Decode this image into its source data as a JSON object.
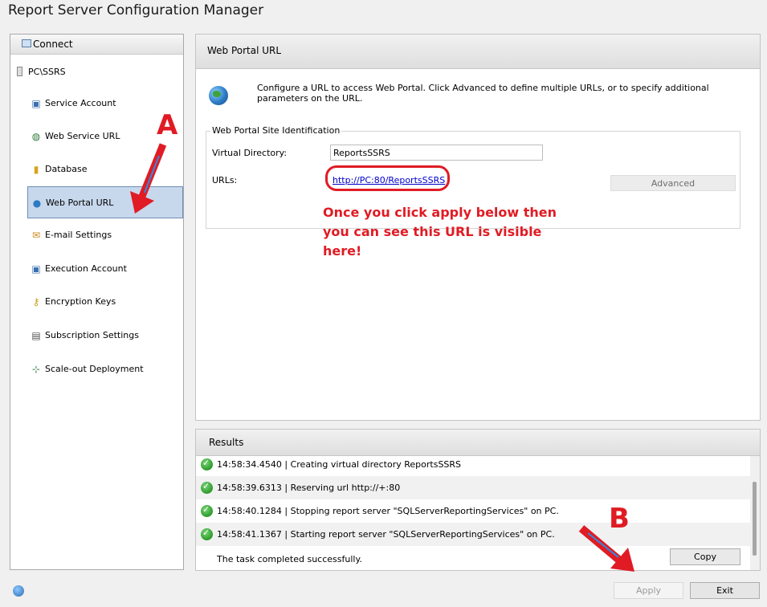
{
  "window": {
    "title": "Report Server Configuration Manager"
  },
  "sidebar": {
    "connect_label": "Connect",
    "server": "PC\\SSRS",
    "items": [
      {
        "label": "Service Account",
        "icon": "service-account-icon"
      },
      {
        "label": "Web Service URL",
        "icon": "web-service-icon"
      },
      {
        "label": "Database",
        "icon": "database-icon"
      },
      {
        "label": "Web Portal URL",
        "icon": "globe-icon",
        "selected": true
      },
      {
        "label": "E-mail Settings",
        "icon": "email-icon"
      },
      {
        "label": "Execution Account",
        "icon": "user-icon"
      },
      {
        "label": "Encryption Keys",
        "icon": "key-icon"
      },
      {
        "label": "Subscription Settings",
        "icon": "subscription-icon"
      },
      {
        "label": "Scale-out Deployment",
        "icon": "network-icon"
      }
    ]
  },
  "main": {
    "header": "Web Portal URL",
    "description": "Configure a URL to access Web Portal.  Click Advanced to define multiple URLs, or to specify additional parameters on the URL.",
    "group_title": "Web Portal Site Identification",
    "virtual_directory_label": "Virtual Directory:",
    "virtual_directory_value": "ReportsSSRS",
    "urls_label": "URLs:",
    "url": "http://PC:80/ReportsSSRS",
    "advanced_label": "Advanced"
  },
  "annotations": {
    "marker_a": "A",
    "marker_b": "B",
    "note": "Once you click apply below then you can see this URL is visible here!",
    "color": "#e01b24"
  },
  "results": {
    "header": "Results",
    "rows": [
      "14:58:34.4540 | Creating virtual directory ReportsSSRS",
      "14:58:39.6313 | Reserving url http://+:80",
      "14:58:40.1284 | Stopping report server \"SQLServerReportingServices\" on PC.",
      "14:58:41.1367 | Starting report server \"SQLServerReportingServices\" on PC."
    ],
    "completed": "The task completed successfully.",
    "copy_label": "Copy"
  },
  "footer": {
    "apply_label": "Apply",
    "exit_label": "Exit"
  }
}
